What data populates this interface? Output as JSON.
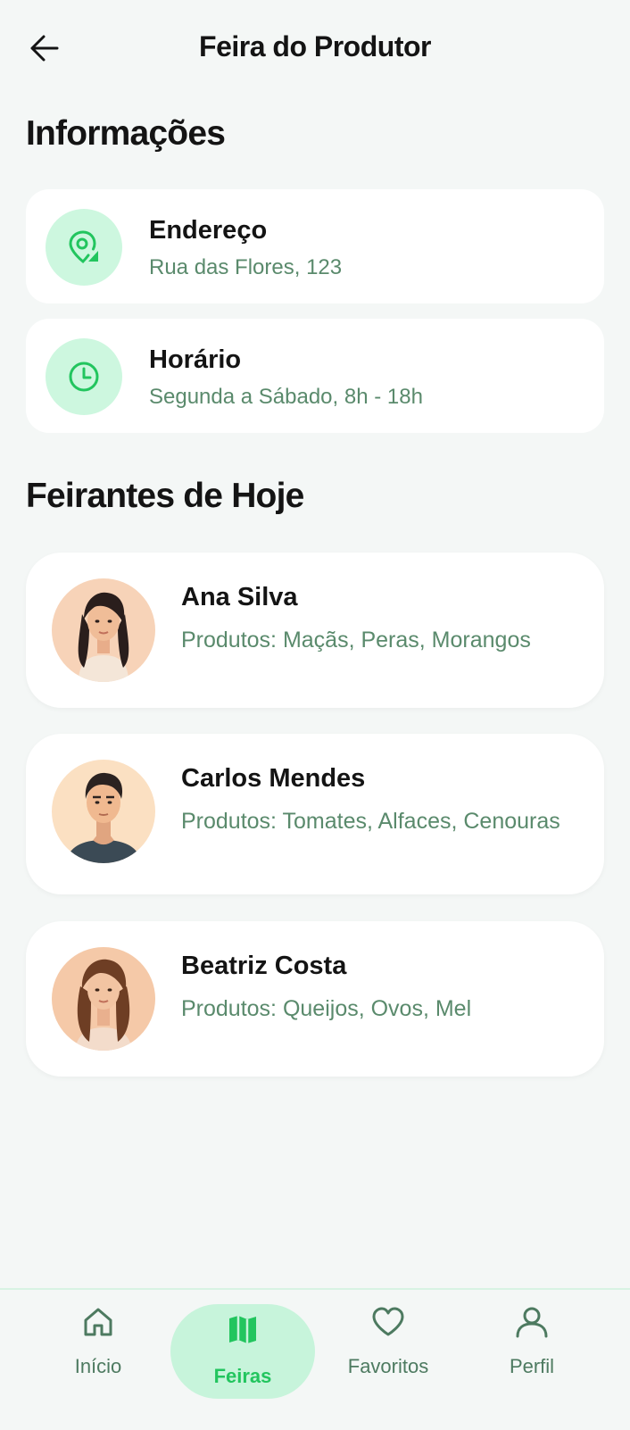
{
  "header": {
    "title": "Feira do Produtor",
    "back_icon": "arrow-left-icon"
  },
  "info_section": {
    "title": "Informações",
    "items": [
      {
        "label": "Endereço",
        "value": "Rua das Flores, 123",
        "icon": "location-pin-icon"
      },
      {
        "label": "Horário",
        "value": "Segunda a Sábado, 8h - 18h",
        "icon": "clock-icon"
      }
    ]
  },
  "vendors_section": {
    "title": "Feirantes de Hoje",
    "vendors": [
      {
        "name": "Ana Silva",
        "products": "Produtos: Maçãs, Peras, Morangos"
      },
      {
        "name": "Carlos Mendes",
        "products": "Produtos: Tomates, Alfaces, Cenouras"
      },
      {
        "name": "Beatriz Costa",
        "products": "Produtos: Queijos, Ovos, Mel"
      }
    ]
  },
  "nav": {
    "items": [
      {
        "label": "Início",
        "icon": "home-icon",
        "active": false
      },
      {
        "label": "Feiras",
        "icon": "map-icon",
        "active": true
      },
      {
        "label": "Favoritos",
        "icon": "heart-icon",
        "active": false
      },
      {
        "label": "Perfil",
        "icon": "user-icon",
        "active": false
      }
    ]
  },
  "colors": {
    "accent": "#22c55e",
    "accent_light": "#cdf7df",
    "muted_text": "#5a8a6c",
    "background": "#f4f7f6"
  }
}
